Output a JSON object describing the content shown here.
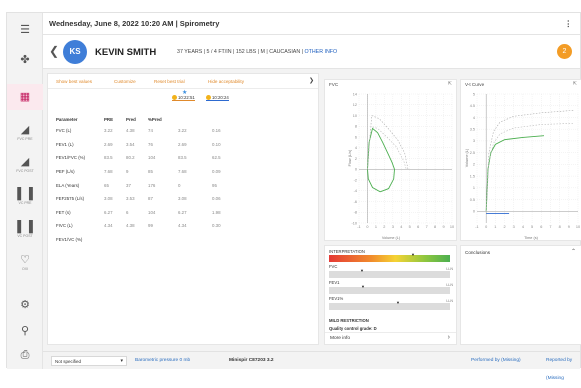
{
  "header": {
    "title": "Wednesday, June 8, 2022 10:20 AM | Spirometry",
    "menu_icon": "more-vertical-icon"
  },
  "rail": [
    {
      "icon": "menu-icon",
      "label": ""
    },
    {
      "icon": "lungs-icon",
      "label": ""
    },
    {
      "icon": "calendar-icon",
      "label": ""
    },
    {
      "icon": "slope-icon",
      "label": "FVC PRE"
    },
    {
      "icon": "slope-icon",
      "label": "FVC POST"
    },
    {
      "icon": "bar-chart-icon",
      "label": "VC PRE"
    },
    {
      "icon": "bar-chart-icon",
      "label": "VC POST"
    },
    {
      "icon": "heart-icon",
      "label": "OXI"
    },
    {
      "icon": "gear-icon",
      "label": ""
    },
    {
      "icon": "share-icon",
      "label": ""
    },
    {
      "icon": "print-icon",
      "label": ""
    }
  ],
  "patient": {
    "initials": "KS",
    "name": "KEVIN SMITH",
    "info": "37 YEARS | 5 / 4 FT/IN | 152 LBS | M | CAUCASIAN |",
    "other_info": "OTHER INFO",
    "notifications": "2"
  },
  "toolbar": {
    "show_best": "Show best values",
    "customize": "Customize",
    "reset_best": "Reset best trial",
    "hide_acceptability": "Hide acceptability"
  },
  "trials": [
    {
      "time": "10:22:51"
    },
    {
      "time": "10:20:24"
    }
  ],
  "table": {
    "headers": [
      "Parameter",
      "PRE",
      "Pred",
      "%Pred",
      "",
      ""
    ],
    "rows": [
      [
        "FVC (L)",
        "3.22",
        "4.38",
        "74",
        "3.22",
        "0.16"
      ],
      [
        "FEV1 (L)",
        "2.69",
        "3.54",
        "76",
        "2.69",
        "0.10"
      ],
      [
        "FEV1/FVC (%)",
        "83.5",
        "80.2",
        "104",
        "83.5",
        "62.5"
      ],
      [
        "PEF (L/s)",
        "7.68",
        "9",
        "85",
        "7.68",
        "0.09"
      ],
      [
        "ELA (Years)",
        "65",
        "37",
        "176",
        "0",
        "95"
      ],
      [
        "FEF2575 (L/s)",
        "3.08",
        "3.53",
        "87",
        "3.08",
        "0.06"
      ],
      [
        "FET (s)",
        "6.27",
        "6",
        "104",
        "6.27",
        "1.98"
      ],
      [
        "FIVC (L)",
        "4.34",
        "4.38",
        "99",
        "4.34",
        "0.30"
      ],
      [
        "FEV1/VC (%)",
        "",
        "",
        "",
        "",
        ""
      ]
    ]
  },
  "fvc_chart": {
    "title": "FVC",
    "xlabel": "Volume (L)",
    "ylabel": "Flow (L/s)"
  },
  "vt_chart": {
    "title": "V-t Curve",
    "xlabel": "Time (s)",
    "ylabel": "Volume (L)"
  },
  "interpretation": {
    "title": "INTERPRETATION",
    "items": [
      {
        "label": "FVC",
        "lln": "LLN"
      },
      {
        "label": "FEV1",
        "lln": "LLN"
      },
      {
        "label": "FEV1%",
        "lln": "LLN"
      }
    ],
    "result": "MILD RESTRICTION",
    "quality": "Quality control grade: D",
    "more": "More info"
  },
  "conclusions": {
    "title": "Conclusions"
  },
  "footer": {
    "select_value": "Not specified",
    "barometric": "Barometric pressure 0 mb",
    "device": "Minispir C87203 3.2",
    "performed": "Performed by (Missing)",
    "reported": "Reported by (Missing"
  },
  "chart_data": [
    {
      "type": "line",
      "title": "FVC",
      "xlabel": "Volume (L)",
      "ylabel": "Flow (L/s)",
      "xlim": [
        -1,
        10
      ],
      "ylim": [
        -10,
        14
      ],
      "x_ticks": [
        -1,
        0,
        1,
        2,
        3,
        4,
        5,
        6,
        7,
        8,
        9,
        10
      ],
      "y_ticks": [
        -10,
        -8,
        -6,
        -4,
        -2,
        0,
        2,
        4,
        6,
        8,
        10,
        12,
        14
      ],
      "series": [
        {
          "points": [
            [
              0,
              0
            ],
            [
              0.2,
              5
            ],
            [
              0.6,
              7.6
            ],
            [
              1.2,
              6.8
            ],
            [
              1.8,
              5
            ],
            [
              2.4,
              3
            ],
            [
              2.9,
              1.3
            ],
            [
              3.2,
              0
            ],
            [
              3.1,
              -1.8
            ],
            [
              2.5,
              -3.6
            ],
            [
              1.5,
              -4.2
            ],
            [
              0.6,
              -3.4
            ],
            [
              0.1,
              -1.8
            ],
            [
              0,
              0
            ]
          ],
          "color": "#4caf50"
        },
        {
          "points": [
            [
              0,
              0
            ],
            [
              0.5,
              10
            ],
            [
              1.4,
              9.4
            ],
            [
              2.5,
              7.5
            ],
            [
              3.6,
              5.4
            ],
            [
              4.4,
              3
            ],
            [
              4.8,
              0
            ]
          ],
          "color": "#aaaaaa",
          "dashed": true
        },
        {
          "points": [
            [
              0,
              0
            ],
            [
              0.4,
              8
            ],
            [
              1.2,
              7.6
            ],
            [
              2.3,
              6
            ],
            [
              3.4,
              4.2
            ],
            [
              4.3,
              1.5
            ],
            [
              4.6,
              0
            ]
          ],
          "color": "#bbbbbb",
          "dashed": true
        }
      ]
    },
    {
      "type": "line",
      "title": "V-t Curve",
      "xlabel": "Time (s)",
      "ylabel": "Volume (L)",
      "xlim": [
        -1,
        10
      ],
      "ylim": [
        -0.5,
        5
      ],
      "x_ticks": [
        -1,
        0,
        1,
        2,
        3,
        4,
        5,
        6,
        7,
        8,
        9,
        10
      ],
      "y_ticks": [
        0,
        0.5,
        1,
        1.5,
        2,
        2.5,
        3,
        3.5,
        4,
        4.5,
        5
      ],
      "series": [
        {
          "points": [
            [
              0,
              0
            ],
            [
              0.2,
              1.8
            ],
            [
              0.5,
              2.5
            ],
            [
              1,
              2.85
            ],
            [
              2,
              3.05
            ],
            [
              4,
              3.15
            ],
            [
              6.3,
              3.22
            ]
          ],
          "color": "#4caf50"
        },
        {
          "points": [
            [
              0,
              0
            ],
            [
              0.3,
              2.5
            ],
            [
              0.8,
              3.4
            ],
            [
              1.5,
              3.8
            ],
            [
              3,
              4.05
            ],
            [
              6,
              4.2
            ],
            [
              9.5,
              4.3
            ]
          ],
          "color": "#aaaaaa",
          "dashed": true
        },
        {
          "points": [
            [
              0,
              0
            ],
            [
              0.3,
              2.1
            ],
            [
              0.8,
              2.9
            ],
            [
              1.5,
              3.3
            ],
            [
              3,
              3.55
            ],
            [
              6,
              3.7
            ],
            [
              9.5,
              3.75
            ]
          ],
          "color": "#bbbbbb",
          "dashed": true
        },
        {
          "points": [
            [
              0,
              -0.1
            ],
            [
              2.5,
              -0.1
            ]
          ],
          "color": "#2d6ad0"
        }
      ]
    }
  ]
}
